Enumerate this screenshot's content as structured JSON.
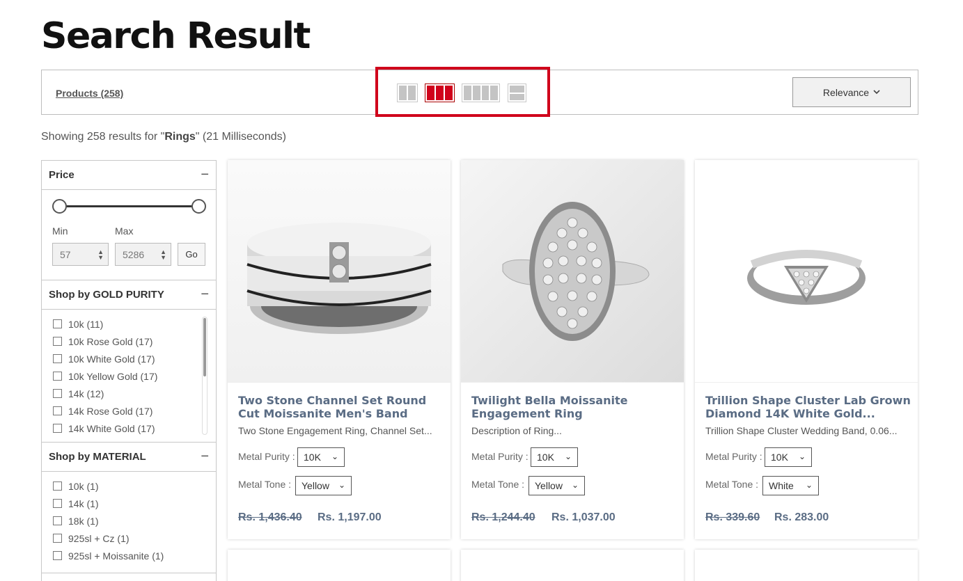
{
  "page": {
    "title": "Search Result"
  },
  "toolbar": {
    "products_count": "Products (258)",
    "view_options": [
      "grid-2-icon",
      "grid-3-icon",
      "grid-4-icon",
      "list-icon"
    ],
    "active_view": "grid-3",
    "sort_label": "Relevance"
  },
  "results": {
    "prefix": "Showing 258 results for \"",
    "query": "Rings",
    "suffix": "\" (21 Milliseconds)"
  },
  "filters": {
    "price": {
      "heading": "Price",
      "min_label": "Min",
      "max_label": "Max",
      "min_value": "57",
      "max_value": "5286",
      "go_label": "Go"
    },
    "gold_purity": {
      "heading": "Shop by GOLD PURITY",
      "items": [
        "10k (11)",
        "10k Rose Gold (17)",
        "10k White Gold (17)",
        "10k Yellow Gold (17)",
        "14k (12)",
        "14k Rose Gold (17)",
        "14k White Gold (17)"
      ]
    },
    "material": {
      "heading": "Shop by MATERIAL",
      "items": [
        "10k (1)",
        "14k (1)",
        "18k (1)",
        "925sl + Cz (1)",
        "925sl + Moissanite (1)"
      ]
    }
  },
  "products": [
    {
      "title": "Two Stone Channel Set Round Cut Moissanite Men's Band",
      "description": "Two Stone Engagement Ring, Channel Set...",
      "purity_label": "Metal Purity :",
      "purity_value": "10K",
      "tone_label": "Metal Tone :",
      "tone_value": "Yellow",
      "old_price": "Rs. 1,436.40",
      "new_price": "Rs. 1,197.00"
    },
    {
      "title": "Twilight Bella Moissanite Engagement Ring",
      "description": "Description of Ring...",
      "purity_label": "Metal Purity :",
      "purity_value": "10K",
      "tone_label": "Metal Tone :",
      "tone_value": "Yellow",
      "old_price": "Rs. 1,244.40",
      "new_price": "Rs. 1,037.00"
    },
    {
      "title": "Trillion Shape Cluster Lab Grown Diamond 14K White Gold...",
      "description": "Trillion Shape Cluster Wedding Band, 0.06...",
      "purity_label": "Metal Purity :",
      "purity_value": "10K",
      "tone_label": "Metal Tone :",
      "tone_value": "White",
      "old_price": "Rs. 339.60",
      "new_price": "Rs. 283.00"
    }
  ],
  "colors": {
    "accent": "#d0021b",
    "title_blue": "#5a6c84"
  }
}
